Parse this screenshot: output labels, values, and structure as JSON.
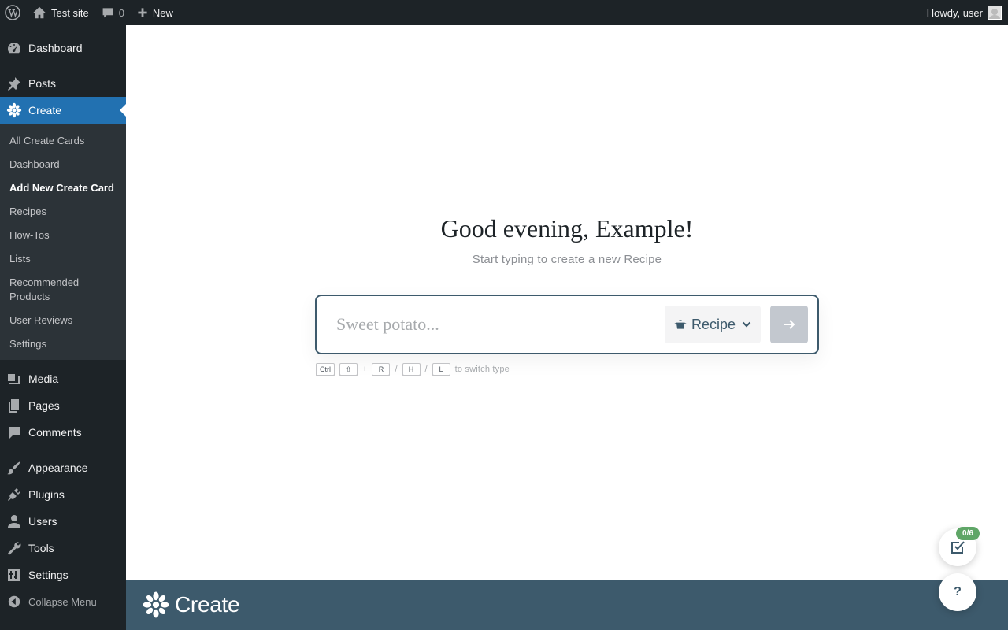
{
  "admin_bar": {
    "site_name": "Test site",
    "comments_count": "0",
    "new_label": "New",
    "greeting": "Howdy, user"
  },
  "sidebar": {
    "items_top": [
      {
        "label": "Dashboard",
        "icon": "dashboard-icon"
      },
      {
        "label": "Posts",
        "icon": "pin-icon"
      },
      {
        "label": "Create",
        "icon": "flower-icon"
      }
    ],
    "submenu": [
      "All Create Cards",
      "Dashboard",
      "Add New Create Card",
      "Recipes",
      "How-Tos",
      "Lists",
      "Recommended Products",
      "User Reviews",
      "Settings"
    ],
    "items_bottom": [
      {
        "label": "Media"
      },
      {
        "label": "Pages"
      },
      {
        "label": "Comments"
      },
      {
        "label": "Appearance"
      },
      {
        "label": "Plugins"
      },
      {
        "label": "Users"
      },
      {
        "label": "Tools"
      },
      {
        "label": "Settings"
      }
    ],
    "collapse_label": "Collapse Menu"
  },
  "main": {
    "greeting": "Good evening, Example!",
    "subtitle": "Start typing to create a new Recipe",
    "input_placeholder": "Sweet potato...",
    "type_label": "Recipe",
    "hint": {
      "keys": [
        "Ctrl",
        "⇧",
        "R",
        "H",
        "L"
      ],
      "plus": "+",
      "slash": "/",
      "text": "to switch type"
    }
  },
  "footer": {
    "logo_text": "Create"
  },
  "floating": {
    "checklist_badge": "0/6",
    "help_label": "?"
  },
  "colors": {
    "accent": "#2271b1",
    "brand": "#3d5a6c",
    "admin_bg": "#1d2327",
    "badge": "#5fa667"
  }
}
